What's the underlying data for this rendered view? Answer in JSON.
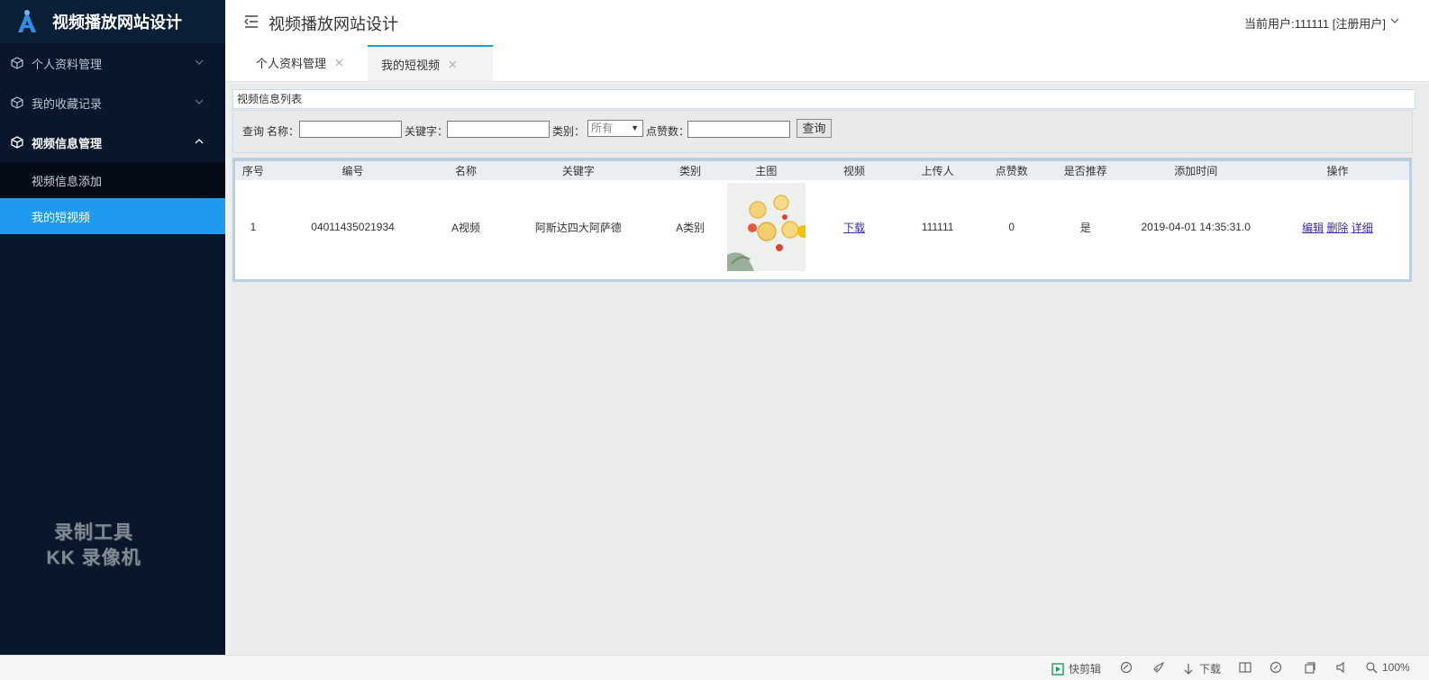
{
  "sidebar": {
    "brand_title": "视频播放网站设计",
    "items": [
      {
        "label": "个人资料管理"
      },
      {
        "label": "我的收藏记录"
      },
      {
        "label": "视频信息管理"
      }
    ],
    "sub_items": [
      {
        "label": "视频信息添加"
      },
      {
        "label": "我的短视频"
      }
    ],
    "watermark_line1": "录制工具",
    "watermark_line2": "KK 录像机"
  },
  "header": {
    "title": "视频播放网站设计",
    "user_info": "当前用户:111111 [注册用户]"
  },
  "tabs": [
    {
      "label": "个人资料管理"
    },
    {
      "label": "我的短视频"
    }
  ],
  "panel": {
    "title": "视频信息列表"
  },
  "search": {
    "query_label": "查询",
    "name_label": "名称：",
    "keyword_label": "关键字：",
    "category_label": "类别：",
    "category_value": "所有",
    "likes_label": "点赞数：",
    "button_label": "查询"
  },
  "table": {
    "headers": [
      "序号",
      "编号",
      "名称",
      "关键字",
      "类别",
      "主图",
      "视频",
      "上传人",
      "点赞数",
      "是否推荐",
      "添加时间",
      "操作"
    ],
    "rows": [
      {
        "index": "1",
        "code": "04011435021934",
        "name": "A视频",
        "keyword": "阿斯达四大阿萨德",
        "category": "A类别",
        "video_link": "下载",
        "uploader": "111111",
        "likes": "0",
        "recommended": "是",
        "added_time": "2019-04-01 14:35:31.0",
        "actions": [
          "编辑",
          "删除",
          "详细"
        ]
      }
    ]
  },
  "statusbar": {
    "quick_edit": "快剪辑",
    "download": "下载",
    "zoom": "100%"
  },
  "colors": {
    "sidebar_bg": "#08172b",
    "accent": "#1e9bef",
    "table_border": "#b8cfe2"
  }
}
